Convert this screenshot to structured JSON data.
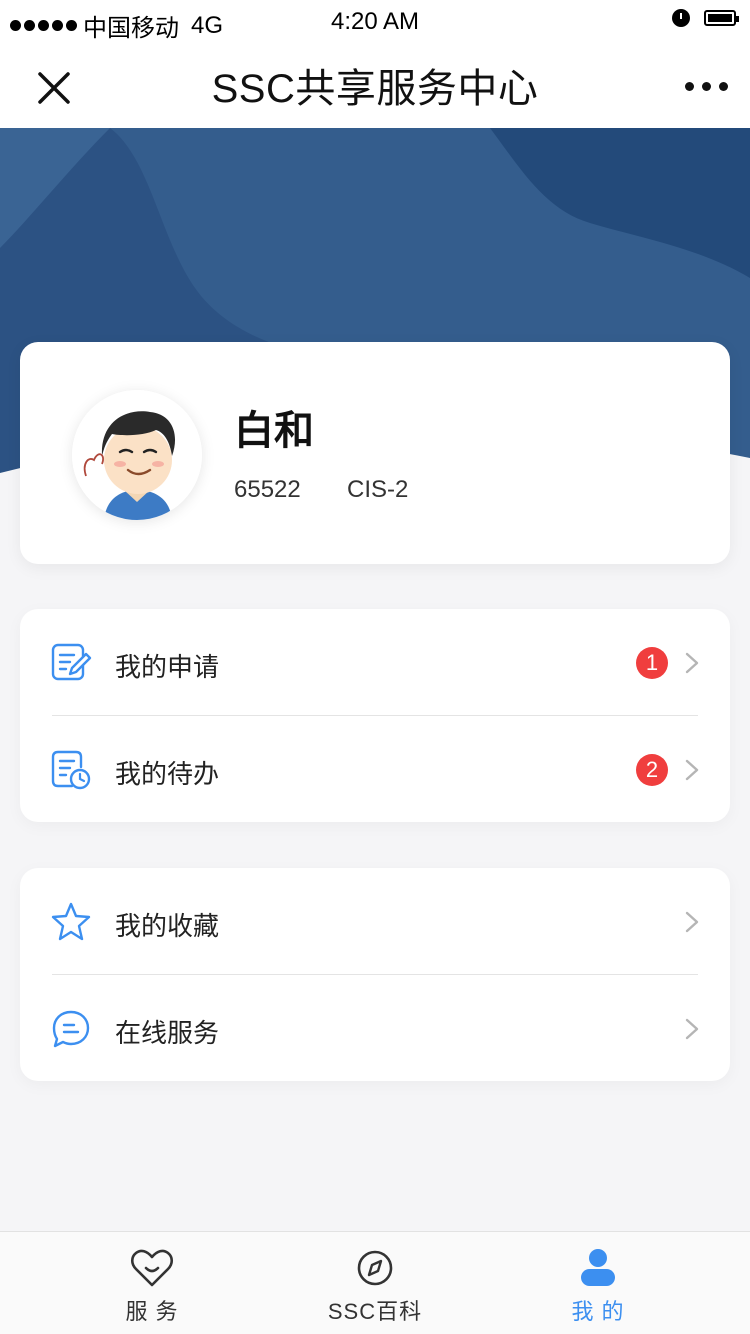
{
  "status_bar": {
    "carrier": "中国移动",
    "network": "4G",
    "time": "4:20 AM"
  },
  "nav": {
    "title": "SSC共享服务中心",
    "close_icon": "close-icon",
    "more_icon": "more-icon"
  },
  "profile": {
    "name": "白和",
    "id": "65522",
    "dept": "CIS-2"
  },
  "menu_groups": [
    {
      "items": [
        {
          "label": "我的申请",
          "icon": "edit-document-icon",
          "badge": "1"
        },
        {
          "label": "我的待办",
          "icon": "document-clock-icon",
          "badge": "2"
        }
      ]
    },
    {
      "items": [
        {
          "label": "我的收藏",
          "icon": "star-icon"
        },
        {
          "label": "在线服务",
          "icon": "chat-bubble-icon"
        }
      ]
    }
  ],
  "tabs": [
    {
      "label": "服 务",
      "icon": "heart-smile-icon",
      "active": false
    },
    {
      "label": "SSC百科",
      "icon": "compass-icon",
      "active": false
    },
    {
      "label": "我 的",
      "icon": "user-icon",
      "active": true
    }
  ],
  "colors": {
    "hero_blue": "#345d8d",
    "accent": "#3c8ff0",
    "badge_red": "#f03e3e"
  }
}
